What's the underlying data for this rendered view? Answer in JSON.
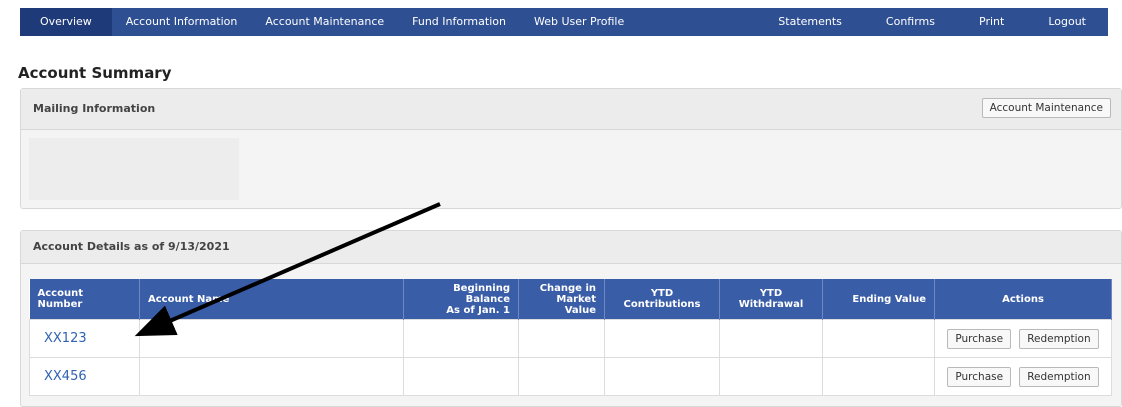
{
  "nav": {
    "left": [
      "Overview",
      "Account Information",
      "Account Maintenance",
      "Fund Information",
      "Web User Profile"
    ],
    "right": [
      "Statements",
      "Confirms",
      "Print",
      "Logout"
    ],
    "active": "Overview"
  },
  "page": {
    "title": "Account Summary"
  },
  "mailing": {
    "title": "Mailing Information",
    "button": "Account Maintenance"
  },
  "details": {
    "title": "Account Details as of 9/13/2021",
    "columns": {
      "account_number": "Account Number",
      "account_name": "Account Name",
      "beginning_balance_1": "Beginning Balance",
      "beginning_balance_2": "As of Jan. 1",
      "change_1": "Change in",
      "change_2": "Market Value",
      "ytd_contrib": "YTD Contributions",
      "ytd_withdrawal": "YTD Withdrawal",
      "ending_value": "Ending Value",
      "actions": "Actions"
    },
    "rows": [
      {
        "account": "XX123",
        "purchase": "Purchase",
        "redemption": "Redemption"
      },
      {
        "account": "XX456",
        "purchase": "Purchase",
        "redemption": "Redemption"
      }
    ]
  },
  "colors": {
    "nav_bg": "#2e4f92",
    "table_header": "#3a5da8",
    "link": "#2f62b3"
  }
}
